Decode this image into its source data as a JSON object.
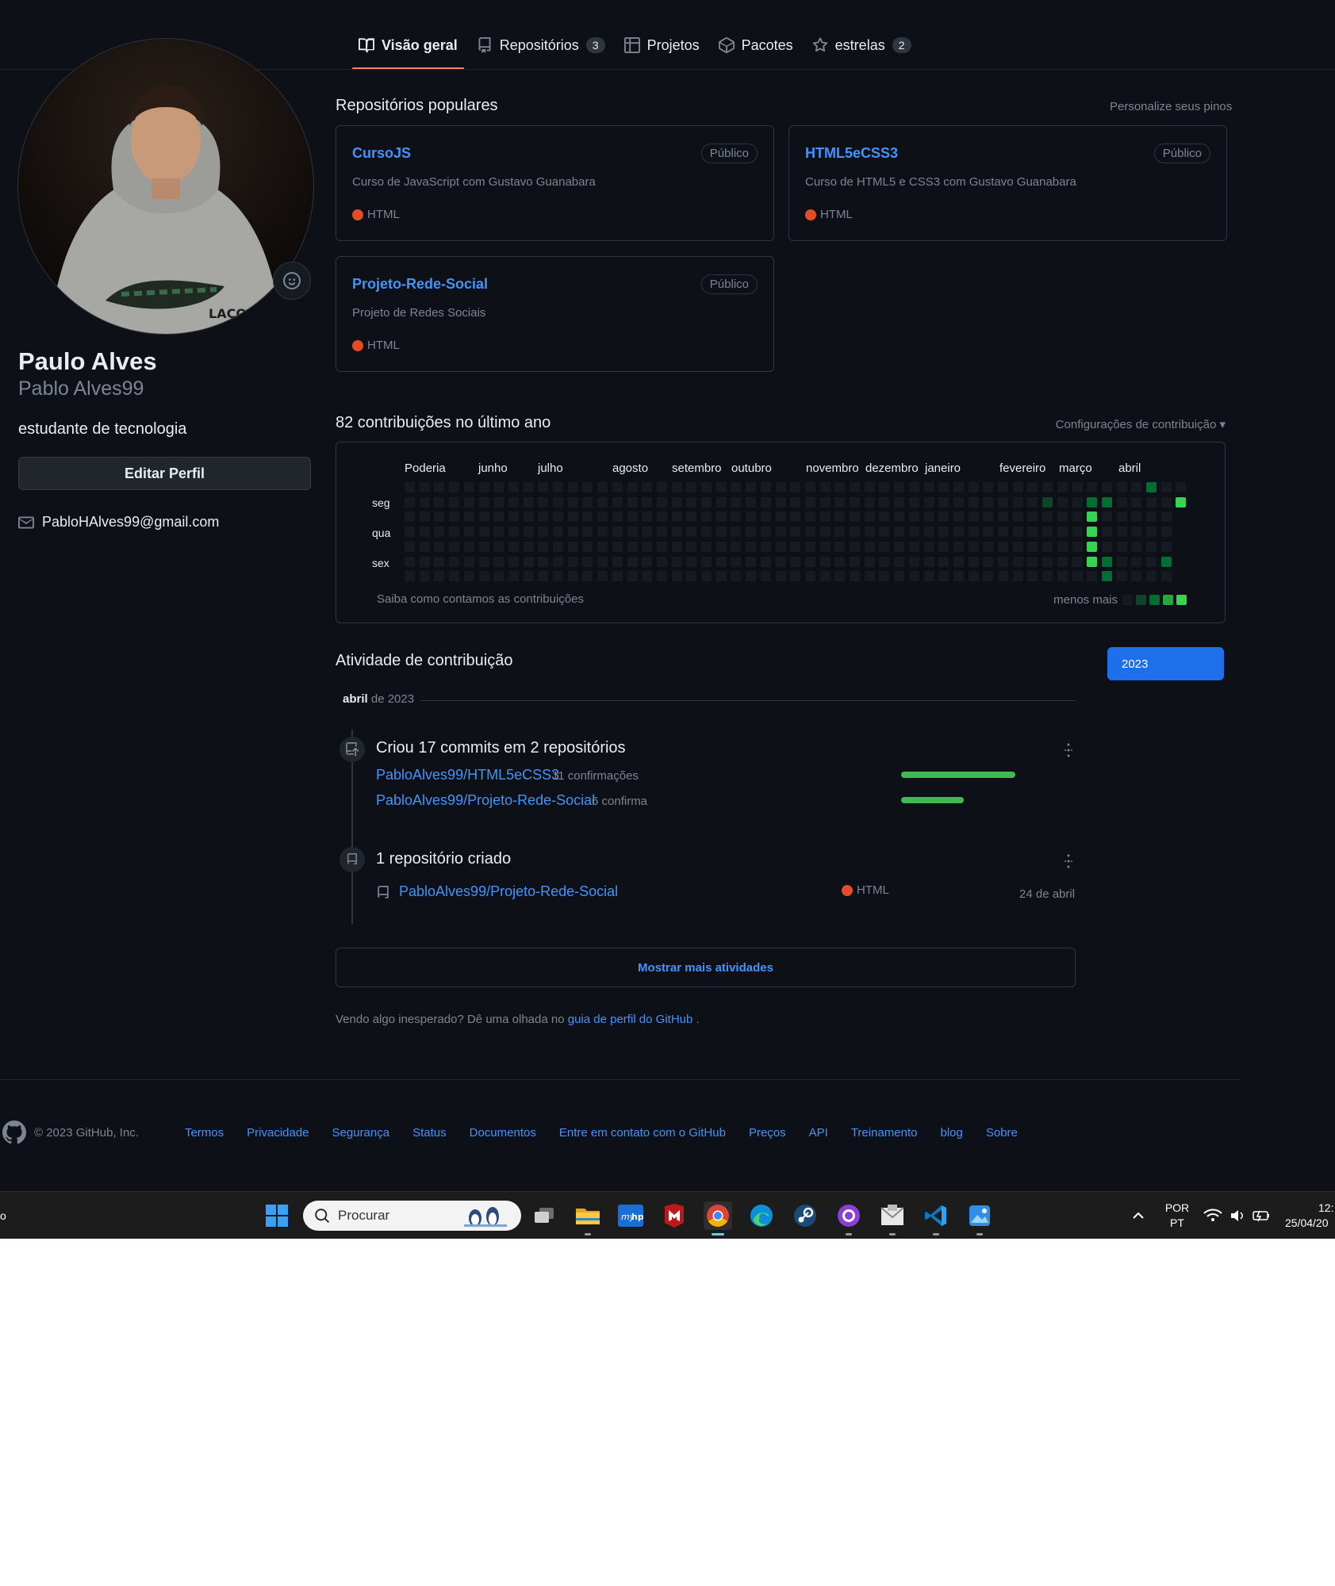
{
  "tabs": [
    {
      "label": "Visão geral",
      "icon": "book-icon"
    },
    {
      "label": "Repositórios",
      "count": "3",
      "icon": "repo-icon"
    },
    {
      "label": "Projetos",
      "icon": "table-icon"
    },
    {
      "label": "Pacotes",
      "icon": "package-icon"
    },
    {
      "label": "estrelas",
      "count": "2",
      "icon": "star-icon"
    }
  ],
  "profile": {
    "name": "Paulo Alves",
    "username": "Pablo Alves99",
    "bio": "estudante de tecnologia",
    "edit_label": "Editar Perfil",
    "email": "PabloHAlves99@gmail.com",
    "avatar_print": "LACOSTE"
  },
  "popular": {
    "title": "Repositórios populares",
    "customize": "Personalize seus pinos",
    "repos": [
      {
        "name": "CursoJS",
        "badge": "Público",
        "desc": "Curso de JavaScript com Gustavo Guanabara",
        "lang": "HTML"
      },
      {
        "name": "HTML5eCSS3",
        "badge": "Público",
        "desc": "Curso de HTML5 e CSS3 com Gustavo Guanabara",
        "lang": "HTML"
      },
      {
        "name": "Projeto-Rede-Social",
        "badge": "Público",
        "desc": "Projeto de Redes Sociais",
        "lang": "HTML"
      }
    ]
  },
  "contrib": {
    "title": "82 contribuições no último ano",
    "settings": "Configurações de contribuição",
    "months": [
      "Poderia",
      "junho",
      "julho",
      "agosto",
      "setembro",
      "outubro",
      "novembro",
      "dezembro",
      "janeiro",
      "fevereiro",
      "março",
      "abril"
    ],
    "days": [
      "seg",
      "qua",
      "sex"
    ],
    "learn": "Saiba como contamos as contribuições",
    "less_more": "menos mais",
    "weeks": 53,
    "levels": [
      {
        "week": 43,
        "day": 1,
        "level": 1
      },
      {
        "week": 46,
        "day": 1,
        "level": 2
      },
      {
        "week": 46,
        "day": 2,
        "level": 4
      },
      {
        "week": 46,
        "day": 3,
        "level": 4
      },
      {
        "week": 46,
        "day": 4,
        "level": 4
      },
      {
        "week": 46,
        "day": 5,
        "level": 4
      },
      {
        "week": 47,
        "day": 1,
        "level": 2
      },
      {
        "week": 47,
        "day": 5,
        "level": 2
      },
      {
        "week": 47,
        "day": 6,
        "level": 2
      },
      {
        "week": 50,
        "day": 0,
        "level": 2
      },
      {
        "week": 51,
        "day": 5,
        "level": 2
      },
      {
        "week": 52,
        "day": 1,
        "level": 4
      }
    ]
  },
  "activity": {
    "title": "Atividade de contribuição",
    "year": "2023",
    "month_bold": "abril",
    "month_rest": "de 2023",
    "commits_title": "Criou 17 commits em 2 repositórios",
    "commit_repos": [
      {
        "name": "PabloAlves99/HTML5eCSS3",
        "meta": "11 confirmações",
        "count": 11
      },
      {
        "name": "PabloAlves99/Projeto-Rede-Social",
        "meta": "6 confirma",
        "count": 6
      }
    ],
    "created_title": "1 repositório criado",
    "created_repo": "PabloAlves99/Projeto-Rede-Social",
    "created_lang": "HTML",
    "created_date": "24 de abril",
    "more": "Mostrar mais atividades",
    "unexpected_pre": "Vendo algo inesperado? Dê uma olhada no",
    "unexpected_link": "guia de perfil do GitHub",
    "unexpected_post": "."
  },
  "footer": {
    "copyright": "© 2023 GitHub, Inc.",
    "links": [
      "Termos",
      "Privacidade",
      "Segurança",
      "Status",
      "Documentos",
      "Entre em contato com o GitHub",
      "Preços",
      "API",
      "Treinamento",
      "blog",
      "Sobre"
    ]
  },
  "taskbar": {
    "search": "Procurar",
    "lang1": "POR",
    "lang2": "PT",
    "time": "12:",
    "date": "25/04/20",
    "left_fragment": "o"
  },
  "colors": {
    "accent": "#4493f8",
    "tab_underline": "#f78166",
    "html_lang": "#e34c26",
    "levels": [
      "#161b22",
      "#0e4429",
      "#006d32",
      "#26a641",
      "#39d353"
    ]
  }
}
